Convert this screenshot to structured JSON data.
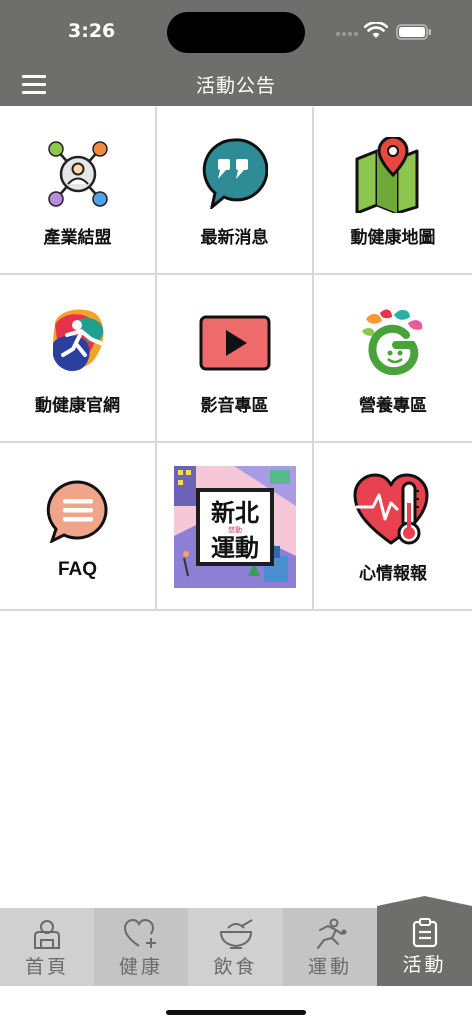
{
  "status": {
    "time": "3:26"
  },
  "header": {
    "title": "活動公告",
    "menu_icon": "hamburger-menu-icon"
  },
  "tiles": [
    {
      "label": "產業結盟",
      "icon": "network-icon"
    },
    {
      "label": "最新消息",
      "icon": "quote-bubble-icon"
    },
    {
      "label": "動健康地圖",
      "icon": "map-pin-icon"
    },
    {
      "label": "動健康官網",
      "icon": "sport-logo-icon"
    },
    {
      "label": "影音專區",
      "icon": "video-play-icon"
    },
    {
      "label": "營養專區",
      "icon": "nutrition-logo-icon"
    },
    {
      "label": "FAQ",
      "icon": "faq-bubble-icon"
    },
    {
      "label": "",
      "icon": "new-taipei-sports-banner",
      "banner": {
        "line1": "新北",
        "small": "悠動",
        "line2": "運動"
      }
    },
    {
      "label": "心情報報",
      "icon": "heart-thermometer-icon"
    }
  ],
  "tabs": [
    {
      "label": "首頁",
      "icon": "home-user-icon"
    },
    {
      "label": "健康",
      "icon": "heart-plus-icon"
    },
    {
      "label": "飲食",
      "icon": "bowl-icon"
    },
    {
      "label": "運動",
      "icon": "runner-icon"
    },
    {
      "label": "活動",
      "icon": "clipboard-icon",
      "active": true
    }
  ],
  "colors": {
    "header_bg": "#6e6e6d",
    "tab_bg": "#d0d0d0",
    "tab_active_bg": "#6e6e6d",
    "grid_line": "#d9d9d9"
  }
}
